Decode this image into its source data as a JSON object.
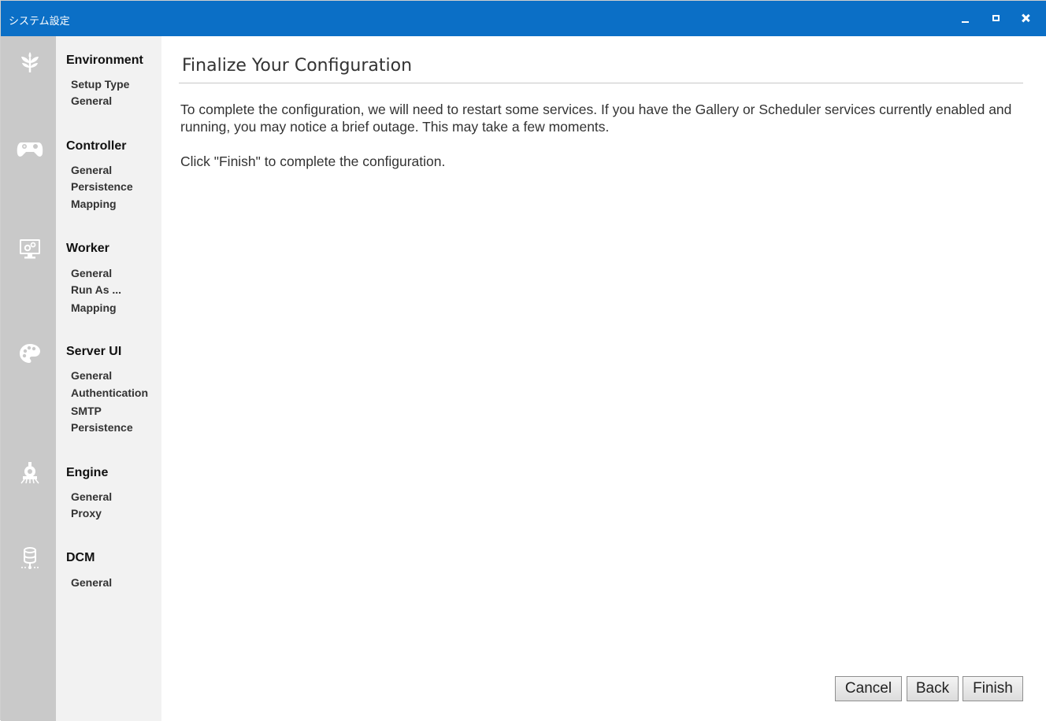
{
  "window": {
    "title": "システム設定"
  },
  "nav": {
    "groups": [
      {
        "title": "Environment",
        "icon": "sprout-icon",
        "items": [
          "Setup Type",
          "General"
        ]
      },
      {
        "title": "Controller",
        "icon": "gamepad-icon",
        "items": [
          "General",
          "Persistence",
          "Mapping"
        ]
      },
      {
        "title": "Worker",
        "icon": "monitor-gears-icon",
        "items": [
          "General",
          "Run As ...",
          "Mapping"
        ]
      },
      {
        "title": "Server UI",
        "icon": "palette-icon",
        "items": [
          "General",
          "Authentication",
          "SMTP",
          "Persistence"
        ]
      },
      {
        "title": "Engine",
        "icon": "train-icon",
        "items": [
          "General",
          "Proxy"
        ]
      },
      {
        "title": "DCM",
        "icon": "database-icon",
        "items": [
          "General"
        ]
      }
    ]
  },
  "main": {
    "title": "Finalize Your Configuration",
    "paragraph1": "To complete the configuration, we will need to restart some services. If you have the Gallery or Scheduler services currently enabled and running, you may notice a brief outage. This may take a few moments.",
    "paragraph2": "Click \"Finish\" to complete the configuration."
  },
  "buttons": {
    "cancel": "Cancel",
    "back": "Back",
    "finish": "Finish"
  },
  "colors": {
    "titlebar": "#0b6fc6",
    "icon_rail": "#c9c9c9",
    "nav_panel": "#f2f2f2"
  }
}
